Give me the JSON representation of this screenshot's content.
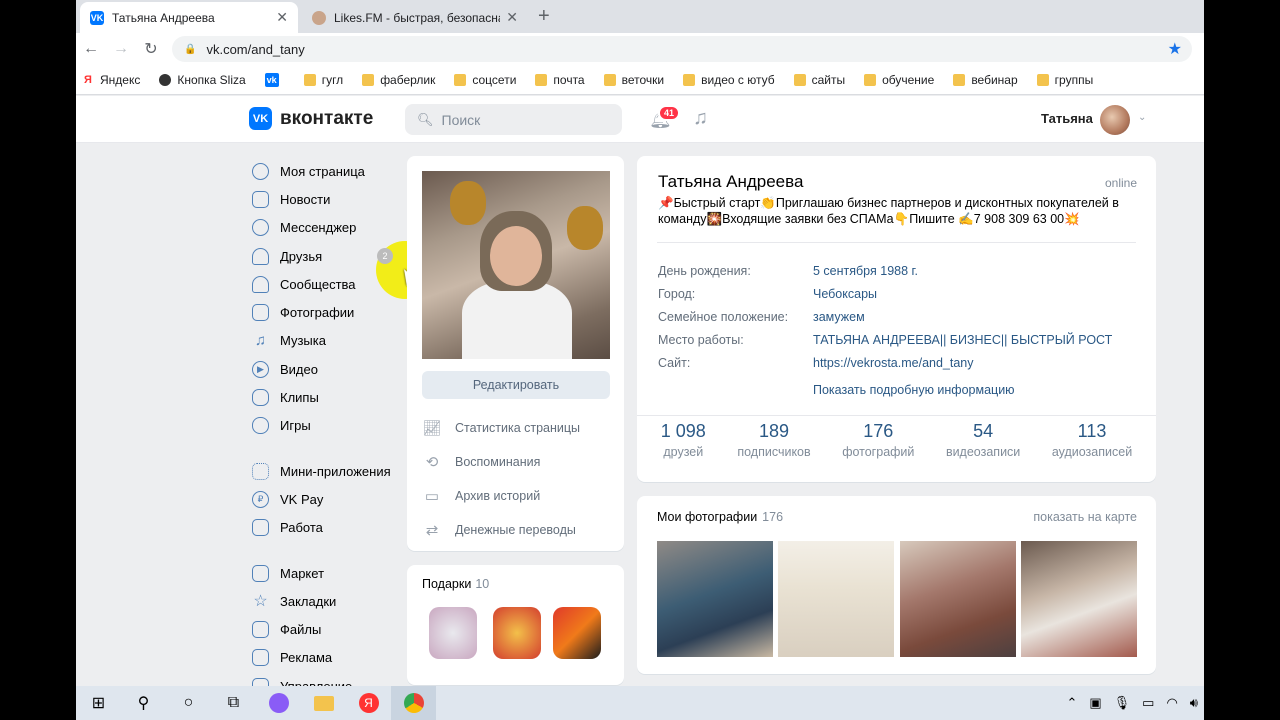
{
  "browser": {
    "tabs": [
      {
        "title": "Татьяна Андреева",
        "active": true
      },
      {
        "title": "Likes.FM - быстрая, безопасная",
        "active": false
      }
    ],
    "new_tab": "+",
    "url": "vk.com/and_tany",
    "bookmarks": [
      {
        "label": "Яндекс",
        "icon": "yandex-icon"
      },
      {
        "label": "Кнопка Sliza",
        "icon": "sliza-icon"
      },
      {
        "label": "",
        "icon": "vk-icon"
      },
      {
        "label": "гугл",
        "icon": "folder-icon"
      },
      {
        "label": "фаберлик",
        "icon": "folder-icon"
      },
      {
        "label": "соцсети",
        "icon": "folder-icon"
      },
      {
        "label": "почта",
        "icon": "folder-icon"
      },
      {
        "label": "веточки",
        "icon": "folder-icon"
      },
      {
        "label": "видео с ютуб",
        "icon": "folder-icon"
      },
      {
        "label": "сайты",
        "icon": "folder-icon"
      },
      {
        "label": "обучение",
        "icon": "folder-icon"
      },
      {
        "label": "вебинар",
        "icon": "folder-icon"
      },
      {
        "label": "группы",
        "icon": "folder-icon"
      }
    ]
  },
  "header": {
    "logo": "вконтакте",
    "search_placeholder": "Поиск",
    "notifications": "41",
    "user_name": "Татьяна"
  },
  "nav": {
    "groups": [
      [
        {
          "label": "Моя страница",
          "icon": "user-icon"
        },
        {
          "label": "Новости",
          "icon": "news-icon"
        },
        {
          "label": "Мессенджер",
          "icon": "message-icon"
        },
        {
          "label": "Друзья",
          "icon": "friends-icon"
        },
        {
          "label": "Сообщества",
          "icon": "communities-icon"
        },
        {
          "label": "Фотографии",
          "icon": "photo-icon"
        },
        {
          "label": "Музыка",
          "icon": "music-icon"
        },
        {
          "label": "Видео",
          "icon": "video-icon"
        },
        {
          "label": "Клипы",
          "icon": "clips-icon"
        },
        {
          "label": "Игры",
          "icon": "games-icon"
        }
      ],
      [
        {
          "label": "Мини-приложения",
          "icon": "apps-icon"
        },
        {
          "label": "VK Pay",
          "icon": "vkpay-icon"
        },
        {
          "label": "Работа",
          "icon": "work-icon"
        }
      ],
      [
        {
          "label": "Маркет",
          "icon": "market-icon"
        },
        {
          "label": "Закладки",
          "icon": "bookmark-icon"
        },
        {
          "label": "Файлы",
          "icon": "files-icon"
        },
        {
          "label": "Реклама",
          "icon": "ads-icon"
        },
        {
          "label": "Управление",
          "icon": "manage-icon"
        }
      ]
    ],
    "friends_badge": "2"
  },
  "avatar_card": {
    "edit_button": "Редактировать",
    "menu": [
      {
        "label": "Статистика страницы",
        "icon": "stats-icon"
      },
      {
        "label": "Воспоминания",
        "icon": "history-icon"
      },
      {
        "label": "Архив историй",
        "icon": "archive-icon"
      },
      {
        "label": "Денежные переводы",
        "icon": "transfer-icon"
      }
    ]
  },
  "gifts": {
    "title": "Подарки",
    "count": "10"
  },
  "profile": {
    "name": "Татьяна Андреева",
    "online": "online",
    "status": "📌Быстрый старт👏Приглашаю бизнес партнеров и дисконтных покупателей в команду🎇Входящие заявки без СПАМа👇Пишите ✍️7 908 309 63 00💥",
    "info": [
      {
        "key": "День рождения:",
        "value": "5 сентября 1988 г."
      },
      {
        "key": "Город:",
        "value": "Чебоксары"
      },
      {
        "key": "Семейное положение:",
        "value": "замужем"
      },
      {
        "key": "Место работы:",
        "value": "ТАТЬЯНА АНДРЕЕВА|| БИЗНЕС|| БЫСТРЫЙ РОСТ"
      },
      {
        "key": "Сайт:",
        "value": "https://vekrosta.me/and_tany"
      }
    ],
    "more_info": "Показать подробную информацию",
    "stats": [
      {
        "n": "1 098",
        "l": "друзей"
      },
      {
        "n": "189",
        "l": "подписчиков"
      },
      {
        "n": "176",
        "l": "фотографий"
      },
      {
        "n": "54",
        "l": "видеозаписи"
      },
      {
        "n": "113",
        "l": "аудиозаписей"
      }
    ]
  },
  "photos": {
    "title": "Мои фотографии",
    "count": "176",
    "map_link": "показать на карте"
  },
  "colors": {
    "vk_blue": "#0077ff",
    "link": "#2a5885",
    "bg": "#edeef0"
  }
}
